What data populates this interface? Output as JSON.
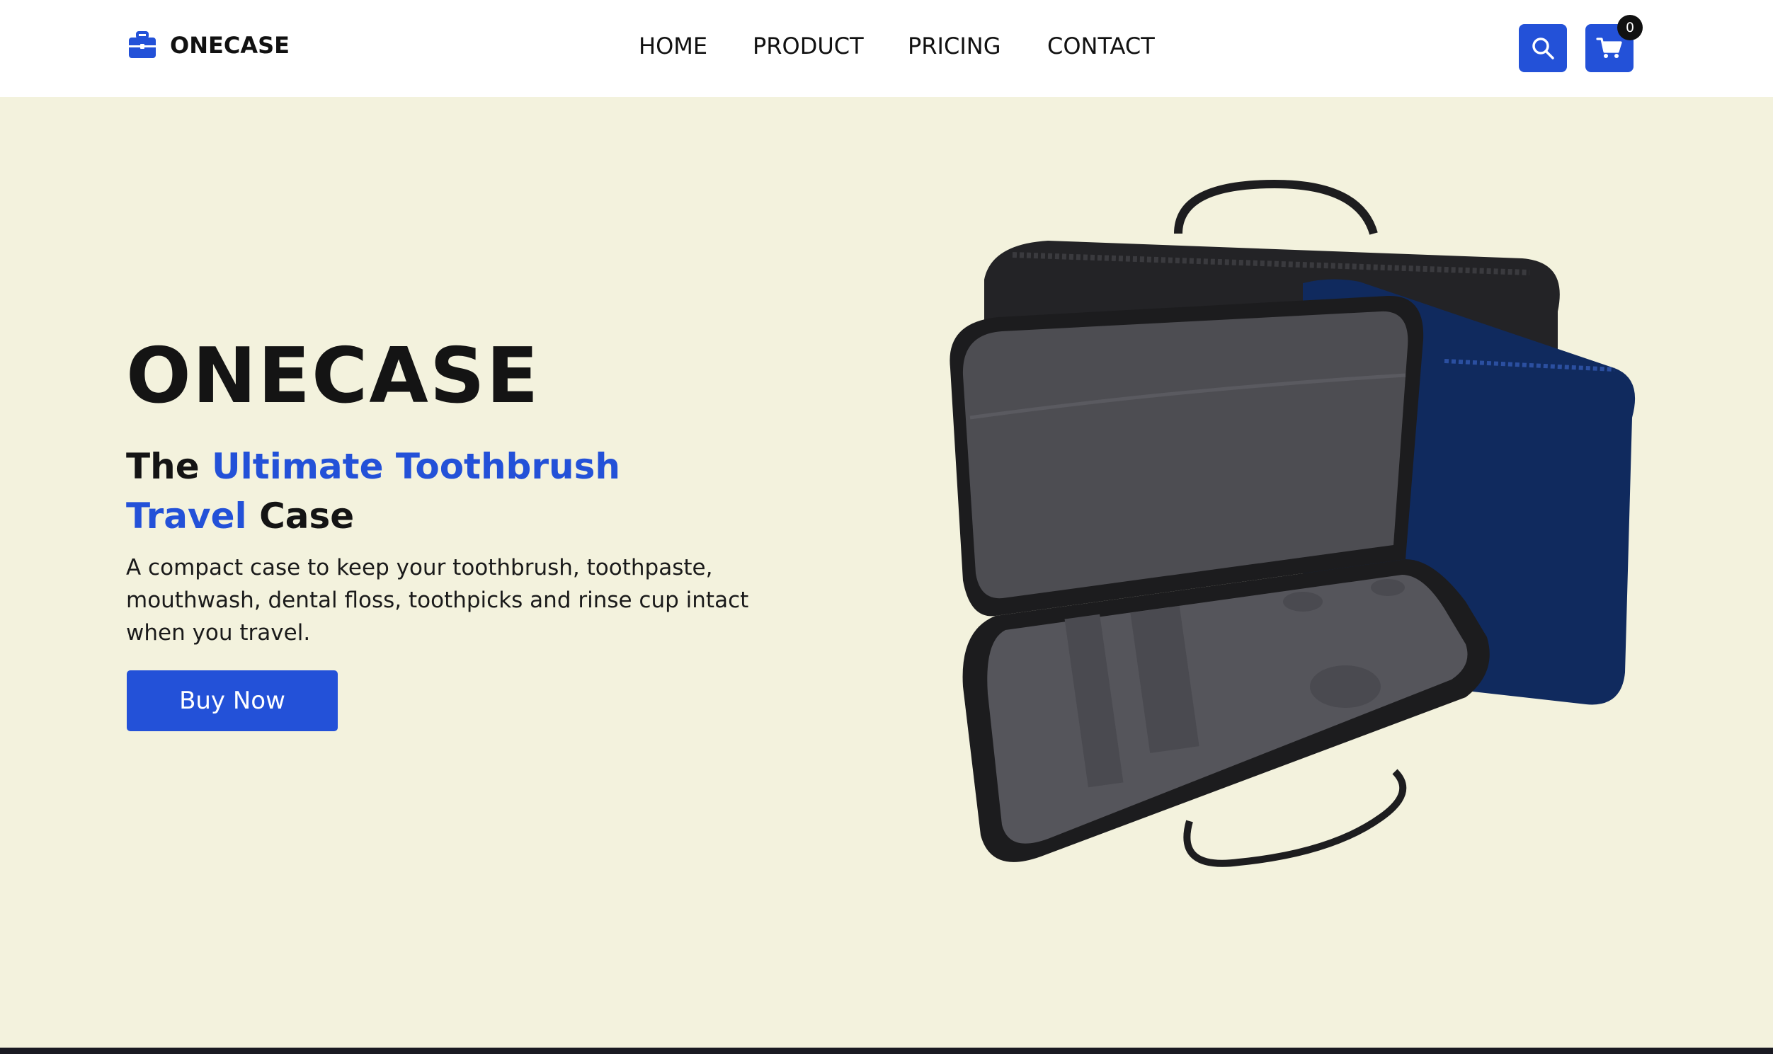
{
  "brand": {
    "name": "ONECASE"
  },
  "nav": {
    "items": [
      {
        "label": "HOME"
      },
      {
        "label": "PRODUCT"
      },
      {
        "label": "PRICING"
      },
      {
        "label": "CONTACT"
      }
    ]
  },
  "cart": {
    "count": "0"
  },
  "icons": {
    "logo": "briefcase-icon",
    "search": "search-icon",
    "cart": "cart-icon"
  },
  "colors": {
    "accent": "#2351d8",
    "hero_bg": "#f3f2dd",
    "header_bg": "#ffffff",
    "text": "#141414"
  },
  "hero": {
    "title": "ONECASE",
    "subtitle_the": "The",
    "subtitle_accent_1": "Ultimate Toothbrush",
    "subtitle_accent_2": "Travel",
    "subtitle_case": "Case",
    "description": "A compact case to keep your toothbrush, toothpaste, mouthwash, dental floss, toothpicks and rinse cup intact when you travel.",
    "cta_label": "Buy Now"
  }
}
